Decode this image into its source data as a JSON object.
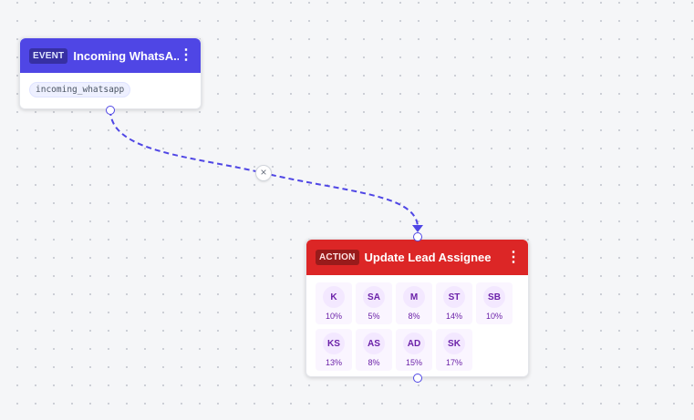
{
  "event_node": {
    "badge": "EVENT",
    "title": "Incoming WhatsA...",
    "tag": "incoming_whatsapp",
    "menu_icon": "kebab-vertical-icon",
    "header_color": "#4f46e5"
  },
  "edge": {
    "delete_icon": "×",
    "color": "#4f46e5"
  },
  "action_node": {
    "badge": "ACTION",
    "title": "Update Lead Assignee",
    "menu_icon": "kebab-vertical-icon",
    "header_color": "#dc2626",
    "assignees": [
      {
        "initials": "K",
        "percent": "10%"
      },
      {
        "initials": "SA",
        "percent": "5%"
      },
      {
        "initials": "M",
        "percent": "8%"
      },
      {
        "initials": "ST",
        "percent": "14%"
      },
      {
        "initials": "SB",
        "percent": "10%"
      },
      {
        "initials": "KS",
        "percent": "13%"
      },
      {
        "initials": "AS",
        "percent": "8%"
      },
      {
        "initials": "AD",
        "percent": "15%"
      },
      {
        "initials": "SK",
        "percent": "17%"
      }
    ]
  }
}
